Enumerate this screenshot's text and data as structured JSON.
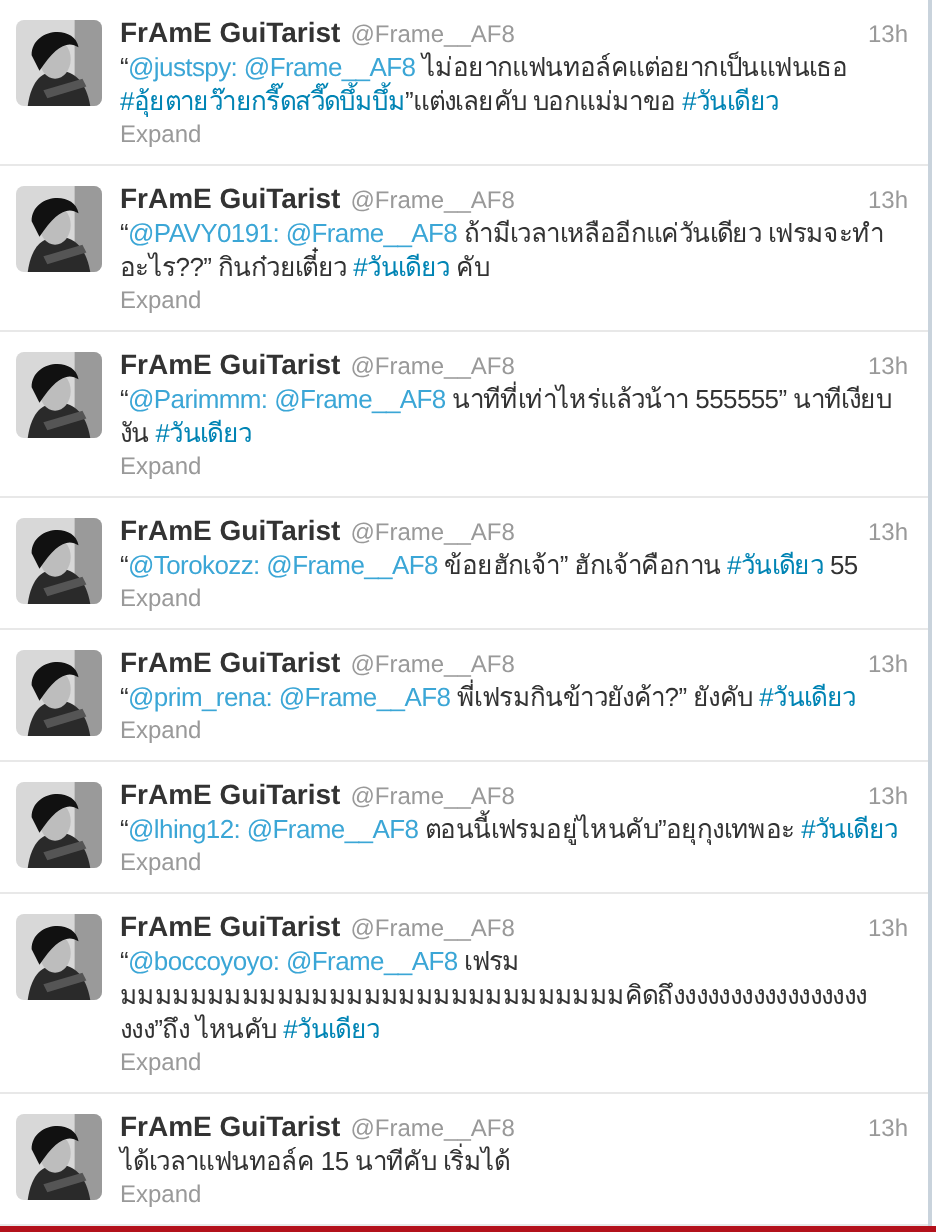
{
  "tweets": [
    {
      "name": "FrAmE GuiTarist",
      "handle": "@Frame__AF8",
      "time": "13h",
      "text": [
        {
          "kind": "plain",
          "text": "“"
        },
        {
          "kind": "mention",
          "text": "@justspy: "
        },
        {
          "kind": "mention",
          "text": "@Frame__AF8"
        },
        {
          "kind": "plain",
          "text": " ไม่อยากแฟนทอล์คแต่อยากเป็นแฟนเธอ "
        },
        {
          "kind": "hashtag",
          "text": "#อุ้ยตายว๊ายกรี๊ดสวี๊ดบึ้มบึ้ม"
        },
        {
          "kind": "plain",
          "text": "”แต่งเลยคับ บอกแม่มาขอ "
        },
        {
          "kind": "hashtag",
          "text": "#วันเดียว"
        }
      ],
      "expand": "Expand"
    },
    {
      "name": "FrAmE GuiTarist",
      "handle": "@Frame__AF8",
      "time": "13h",
      "text": [
        {
          "kind": "plain",
          "text": "“"
        },
        {
          "kind": "mention",
          "text": "@PAVY0191: "
        },
        {
          "kind": "mention",
          "text": "@Frame__AF8"
        },
        {
          "kind": "plain",
          "text": " ถ้ามีเวลาเหลืออีกแค่วันเดียว เฟรมจะทำอะไร??” กินก๋วยเตี๋ยว "
        },
        {
          "kind": "hashtag",
          "text": "#วันเดียว"
        },
        {
          "kind": "plain",
          "text": " คับ"
        }
      ],
      "expand": "Expand"
    },
    {
      "name": "FrAmE GuiTarist",
      "handle": "@Frame__AF8",
      "time": "13h",
      "text": [
        {
          "kind": "plain",
          "text": "“"
        },
        {
          "kind": "mention",
          "text": "@Parimmm: "
        },
        {
          "kind": "mention",
          "text": "@Frame__AF8"
        },
        {
          "kind": "plain",
          "text": " นาทีที่เท่าไหร่แล้วน้าา 555555” นาทีเงียบงัน "
        },
        {
          "kind": "hashtag",
          "text": "#วันเดียว"
        }
      ],
      "expand": "Expand"
    },
    {
      "name": "FrAmE GuiTarist",
      "handle": "@Frame__AF8",
      "time": "13h",
      "text": [
        {
          "kind": "plain",
          "text": "“"
        },
        {
          "kind": "mention",
          "text": "@Torokozz: "
        },
        {
          "kind": "mention",
          "text": "@Frame__AF8"
        },
        {
          "kind": "plain",
          "text": " ข้อยฮักเจ้า” ฮักเจ้าคือกาน "
        },
        {
          "kind": "hashtag",
          "text": "#วันเดียว"
        },
        {
          "kind": "plain",
          "text": " 55"
        }
      ],
      "expand": "Expand"
    },
    {
      "name": "FrAmE GuiTarist",
      "handle": "@Frame__AF8",
      "time": "13h",
      "text": [
        {
          "kind": "plain",
          "text": "“"
        },
        {
          "kind": "mention",
          "text": "@prim_rena: "
        },
        {
          "kind": "mention",
          "text": "@Frame__AF8"
        },
        {
          "kind": "plain",
          "text": " พี่เฟรมกินข้าวยังค้า?” ยังคับ "
        },
        {
          "kind": "hashtag",
          "text": "#วันเดียว"
        }
      ],
      "expand": "Expand"
    },
    {
      "name": "FrAmE GuiTarist",
      "handle": "@Frame__AF8",
      "time": "13h",
      "text": [
        {
          "kind": "plain",
          "text": "“"
        },
        {
          "kind": "mention",
          "text": "@lhing12: "
        },
        {
          "kind": "mention",
          "text": "@Frame__AF8"
        },
        {
          "kind": "plain",
          "text": " ตอนนี้เฟรมอยู่ไหนคับ”อยุกุงเทพอะ "
        },
        {
          "kind": "hashtag",
          "text": "#วันเดียว"
        }
      ],
      "expand": "Expand"
    },
    {
      "name": "FrAmE GuiTarist",
      "handle": "@Frame__AF8",
      "time": "13h",
      "text": [
        {
          "kind": "plain",
          "text": "“"
        },
        {
          "kind": "mention",
          "text": "@boccoyoyo: "
        },
        {
          "kind": "mention",
          "text": "@Frame__AF8"
        },
        {
          "kind": "plain",
          "text": " เฟรม มมมมมมมมมมมมมมมมมมมมมมมมมมมมมคิดถึงงงงงงงงงงงงงงงงงงงง”ถึง ไหนคับ "
        },
        {
          "kind": "hashtag",
          "text": "#วันเดียว"
        }
      ],
      "expand": "Expand"
    },
    {
      "name": "FrAmE GuiTarist",
      "handle": "@Frame__AF8",
      "time": "13h",
      "text": [
        {
          "kind": "plain",
          "text": "ได้เวลาแฟนทอล์ค 15 นาทีคับ เริ่มได้"
        }
      ],
      "expand": "Expand"
    }
  ]
}
